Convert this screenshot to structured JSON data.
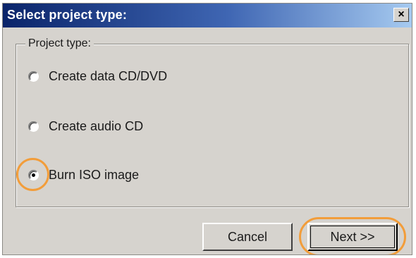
{
  "window": {
    "title": "Select project type:",
    "close_glyph": "×"
  },
  "group": {
    "label": "Project type:"
  },
  "options": [
    {
      "label": "Create data CD/DVD",
      "checked": false
    },
    {
      "label": "Create audio CD",
      "checked": false
    },
    {
      "label": "Burn ISO image",
      "checked": true
    }
  ],
  "buttons": {
    "cancel": "Cancel",
    "next": "Next >>"
  },
  "colors": {
    "highlight": "#f29d3a",
    "title_bar_start": "#0a246a",
    "title_bar_end": "#a6caf0",
    "dialog_background": "#d6d3ce"
  },
  "icons": {
    "close": "close-icon"
  }
}
